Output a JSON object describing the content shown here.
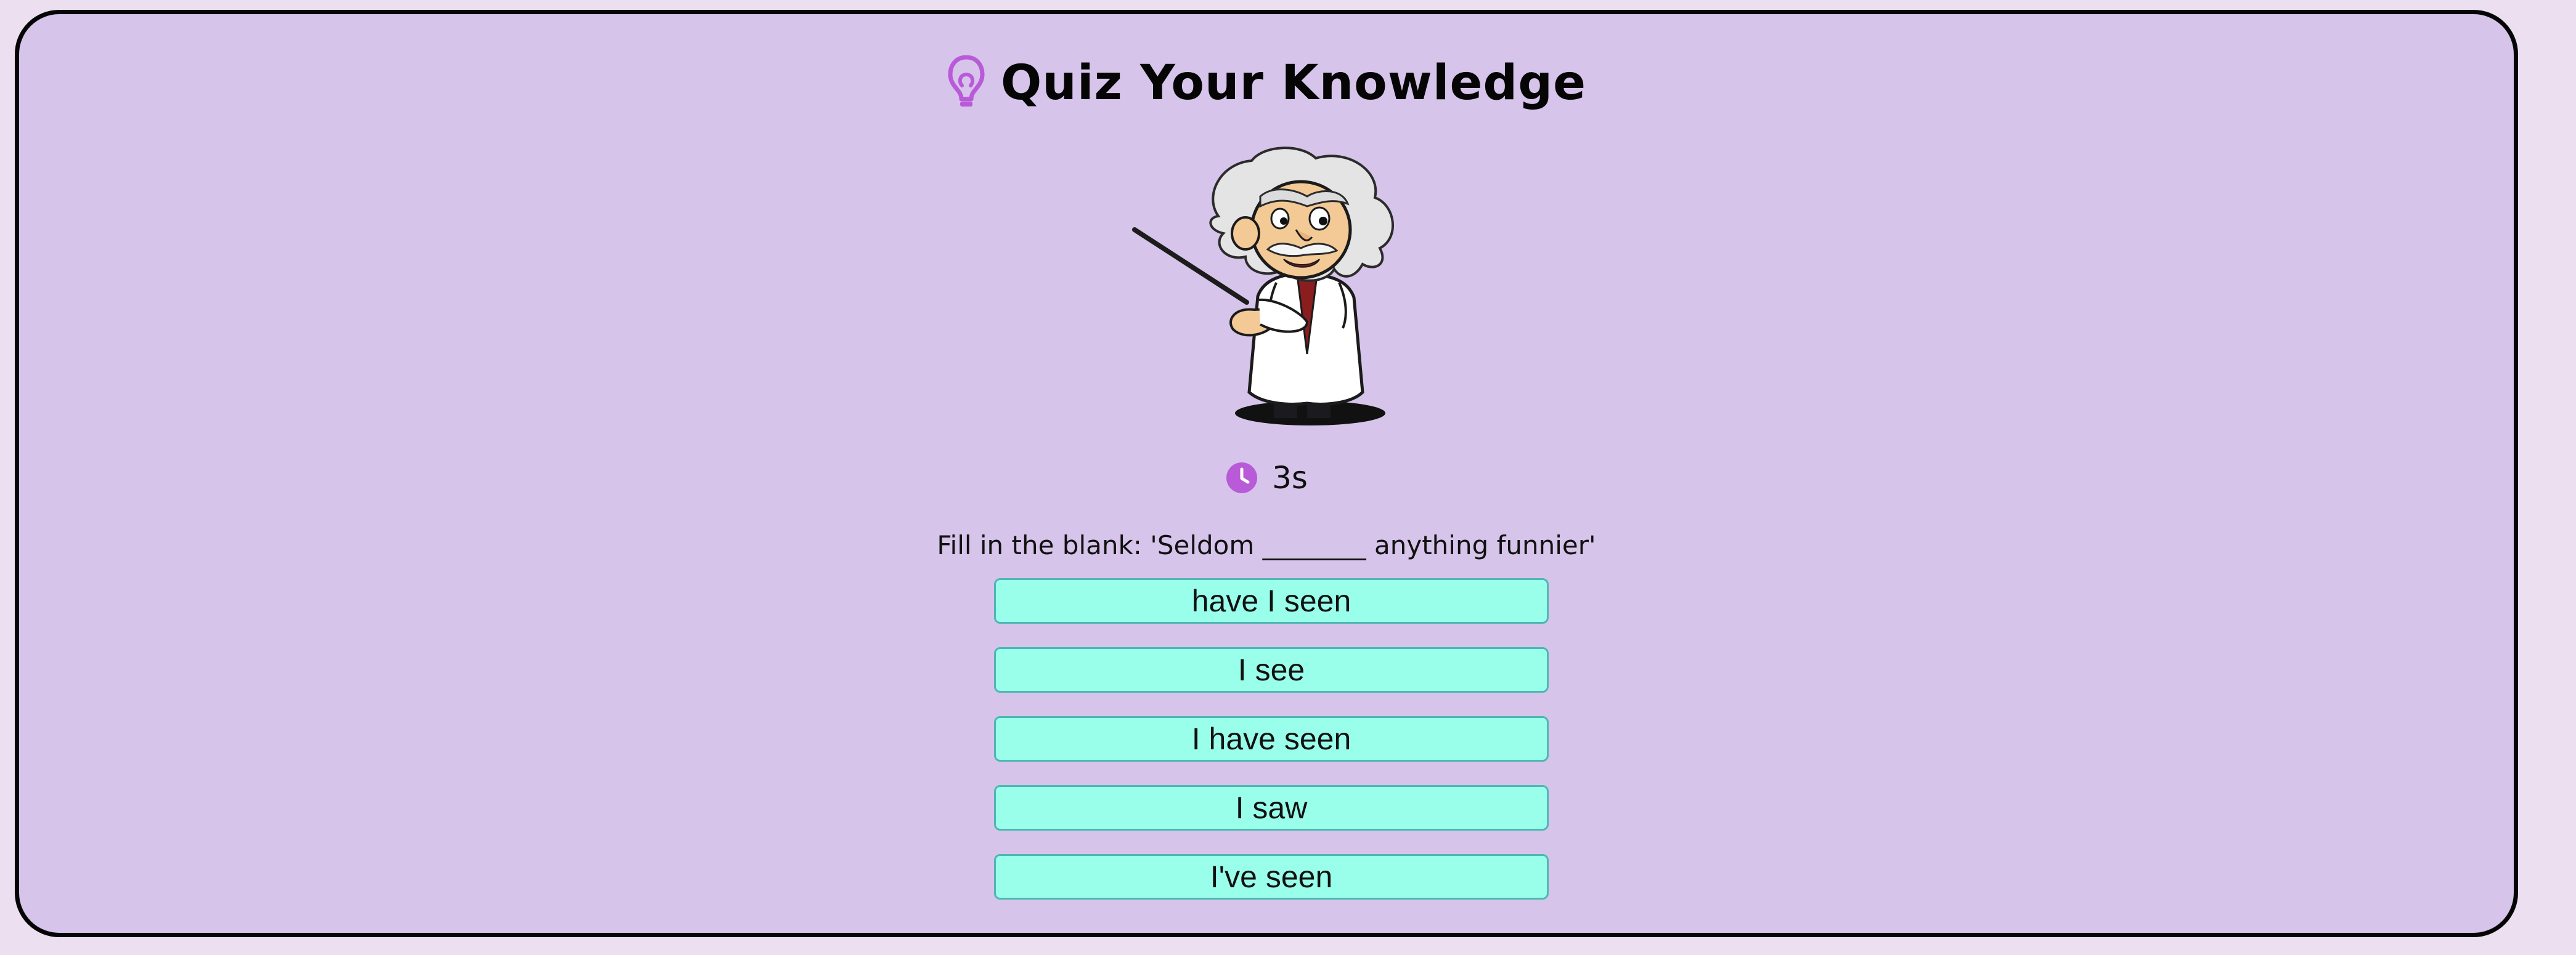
{
  "header": {
    "title": "Quiz Your Knowledge",
    "icon": "lightbulb-icon"
  },
  "mascot": {
    "icon": "professor-mascot"
  },
  "timer": {
    "icon": "clock-icon",
    "value": "3s"
  },
  "quiz": {
    "question": "Fill in the blank: 'Seldom ________ anything funnier'",
    "answers": [
      {
        "label": "have I seen"
      },
      {
        "label": "I see"
      },
      {
        "label": "I have seen"
      },
      {
        "label": "I saw"
      },
      {
        "label": "I've seen"
      }
    ]
  },
  "colors": {
    "page_background": "#ecdff0",
    "panel_background": "#d6c4ea",
    "panel_border": "#050505",
    "accent": "#b95ad9",
    "answer_background": "#99ffea",
    "answer_border": "#4fb7b2"
  }
}
